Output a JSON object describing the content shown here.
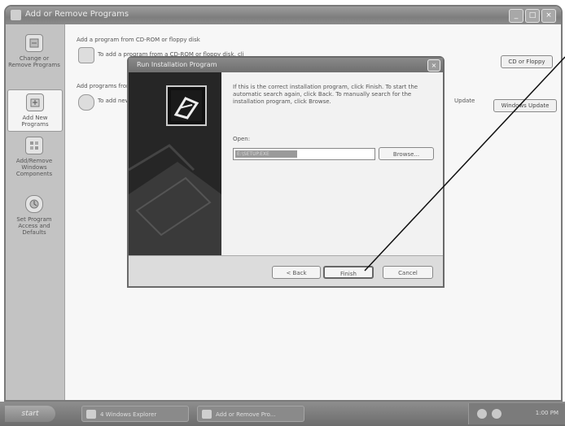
{
  "window": {
    "title": "Add or Remove Programs",
    "controls": [
      "_",
      "□",
      "×"
    ]
  },
  "sidebar": {
    "items": [
      {
        "label": "Change or Remove Programs",
        "icon": "change-remove-icon",
        "active": false
      },
      {
        "label": "Add New Programs",
        "icon": "add-programs-icon",
        "active": true
      },
      {
        "label": "Add/Remove Windows Components",
        "icon": "windows-components-icon",
        "active": false
      },
      {
        "label": "Set Program Access and Defaults",
        "icon": "program-access-icon",
        "active": false
      }
    ]
  },
  "main": {
    "cd_heading": "Add a program from CD-ROM or floppy disk",
    "cd_text": "To add a program from a CD-ROM or floppy disk, click CD or Floppy.",
    "cd_button": "CD or Floppy",
    "ms_heading": "Add programs from Microsoft",
    "ms_text": "To add new Windows features, device drivers, and system updates over the Internet, click Windows Update.",
    "ms_update_word": "Update",
    "ms_button": "Windows Update"
  },
  "dialog": {
    "title": "Run Installation Program",
    "description": "If this is the correct installation program, click Finish. To start the automatic search again, click Back. To manually search for the installation program, click Browse.",
    "open_label": "Open:",
    "open_value": "E:\\SETUP.EXE",
    "browse_button": "Browse...",
    "back_button": "< Back",
    "finish_button": "Finish",
    "cancel_button": "Cancel"
  },
  "taskbar": {
    "start": "start",
    "tasks": [
      {
        "label": "4 Windows Explorer"
      },
      {
        "label": "Add or Remove Pro..."
      }
    ],
    "clock": "1:00 PM"
  },
  "colors": {
    "dialog_side": "#262626",
    "titlebar": "#8a8a8a",
    "pointer_line": "#111111"
  }
}
